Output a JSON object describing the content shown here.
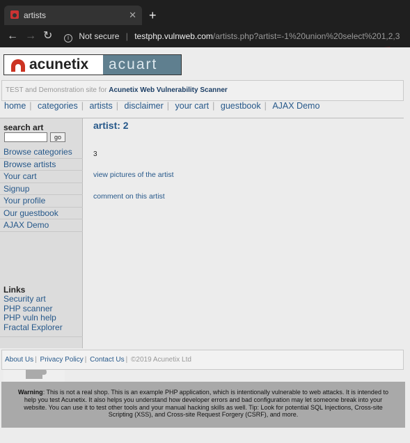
{
  "browser": {
    "tab_title": "artists",
    "tab_close": "✕",
    "new_tab": "+",
    "back": "←",
    "forward": "→",
    "reload": "↻",
    "security_text": "Not secure",
    "url_host": "testphp.vulnweb.com",
    "url_path": "/artists.php?artist=-1%20union%20select%201,2,3"
  },
  "logo": {
    "left": "acunetix",
    "right": "acuart"
  },
  "banner": {
    "prefix": "TEST and Demonstration site for",
    "highlight": "Acunetix Web Vulnerability Scanner"
  },
  "topnav": [
    "home",
    "categories",
    "artists",
    "disclaimer",
    "your cart",
    "guestbook",
    "AJAX Demo"
  ],
  "sidebar": {
    "search_title": "search art",
    "go_label": "go",
    "menu": [
      "Browse categories",
      "Browse artists",
      "Your cart",
      "Signup",
      "Your profile",
      "Our guestbook",
      "AJAX Demo"
    ],
    "links_title": "Links",
    "links": [
      "Security art",
      "PHP scanner",
      "PHP vuln help",
      "Fractal Explorer"
    ],
    "puzzle_icon": "puzzle-icon"
  },
  "content": {
    "artist_title": "artist: 2",
    "artist_value": "3",
    "view_pictures": "view pictures of the artist",
    "comment": "comment on this artist"
  },
  "footer": {
    "about": "About Us",
    "privacy": "Privacy Policy",
    "contact": "Contact Us",
    "copyright": "©2019 Acunetix Ltd"
  },
  "warning": {
    "label": "Warning",
    "text": ": This is not a real shop. This is an example PHP application, which is intentionally vulnerable to web attacks. It is intended to help you test Acunetix. It also helps you understand how developer errors and bad configuration may let someone break into your website. You can use it to test other tools and your manual hacking skills as well. Tip: Look for potential SQL Injections, Cross-site Scripting (XSS), and Cross-site Request Forgery (CSRF), and more."
  },
  "colors": {
    "annotation": "#e02020",
    "link": "#26588a"
  }
}
